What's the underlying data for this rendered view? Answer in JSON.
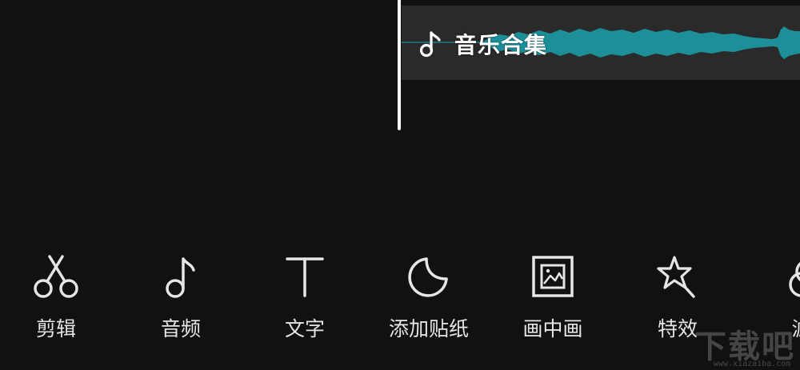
{
  "timeline": {
    "audio_track": {
      "title": "音乐合集",
      "icon": "music-note-icon",
      "waveform_color": "#1c8f99",
      "track_color": "#2a2a2a"
    },
    "playhead_color": "#ffffff"
  },
  "toolbar": {
    "items": [
      {
        "label": "剪辑",
        "icon": "scissors-icon"
      },
      {
        "label": "音频",
        "icon": "music-note-icon"
      },
      {
        "label": "文字",
        "icon": "text-t-icon"
      },
      {
        "label": "添加贴纸",
        "icon": "sticker-icon"
      },
      {
        "label": "画中画",
        "icon": "picture-in-picture-icon"
      },
      {
        "label": "特效",
        "icon": "star-magic-icon"
      },
      {
        "label": "滤",
        "icon": "filter-icon"
      }
    ],
    "text_color": "#e6e6e6",
    "icon_color": "#e6e6e6"
  },
  "watermark": {
    "text": "下载吧",
    "url": "www.xiazaiba.com"
  }
}
